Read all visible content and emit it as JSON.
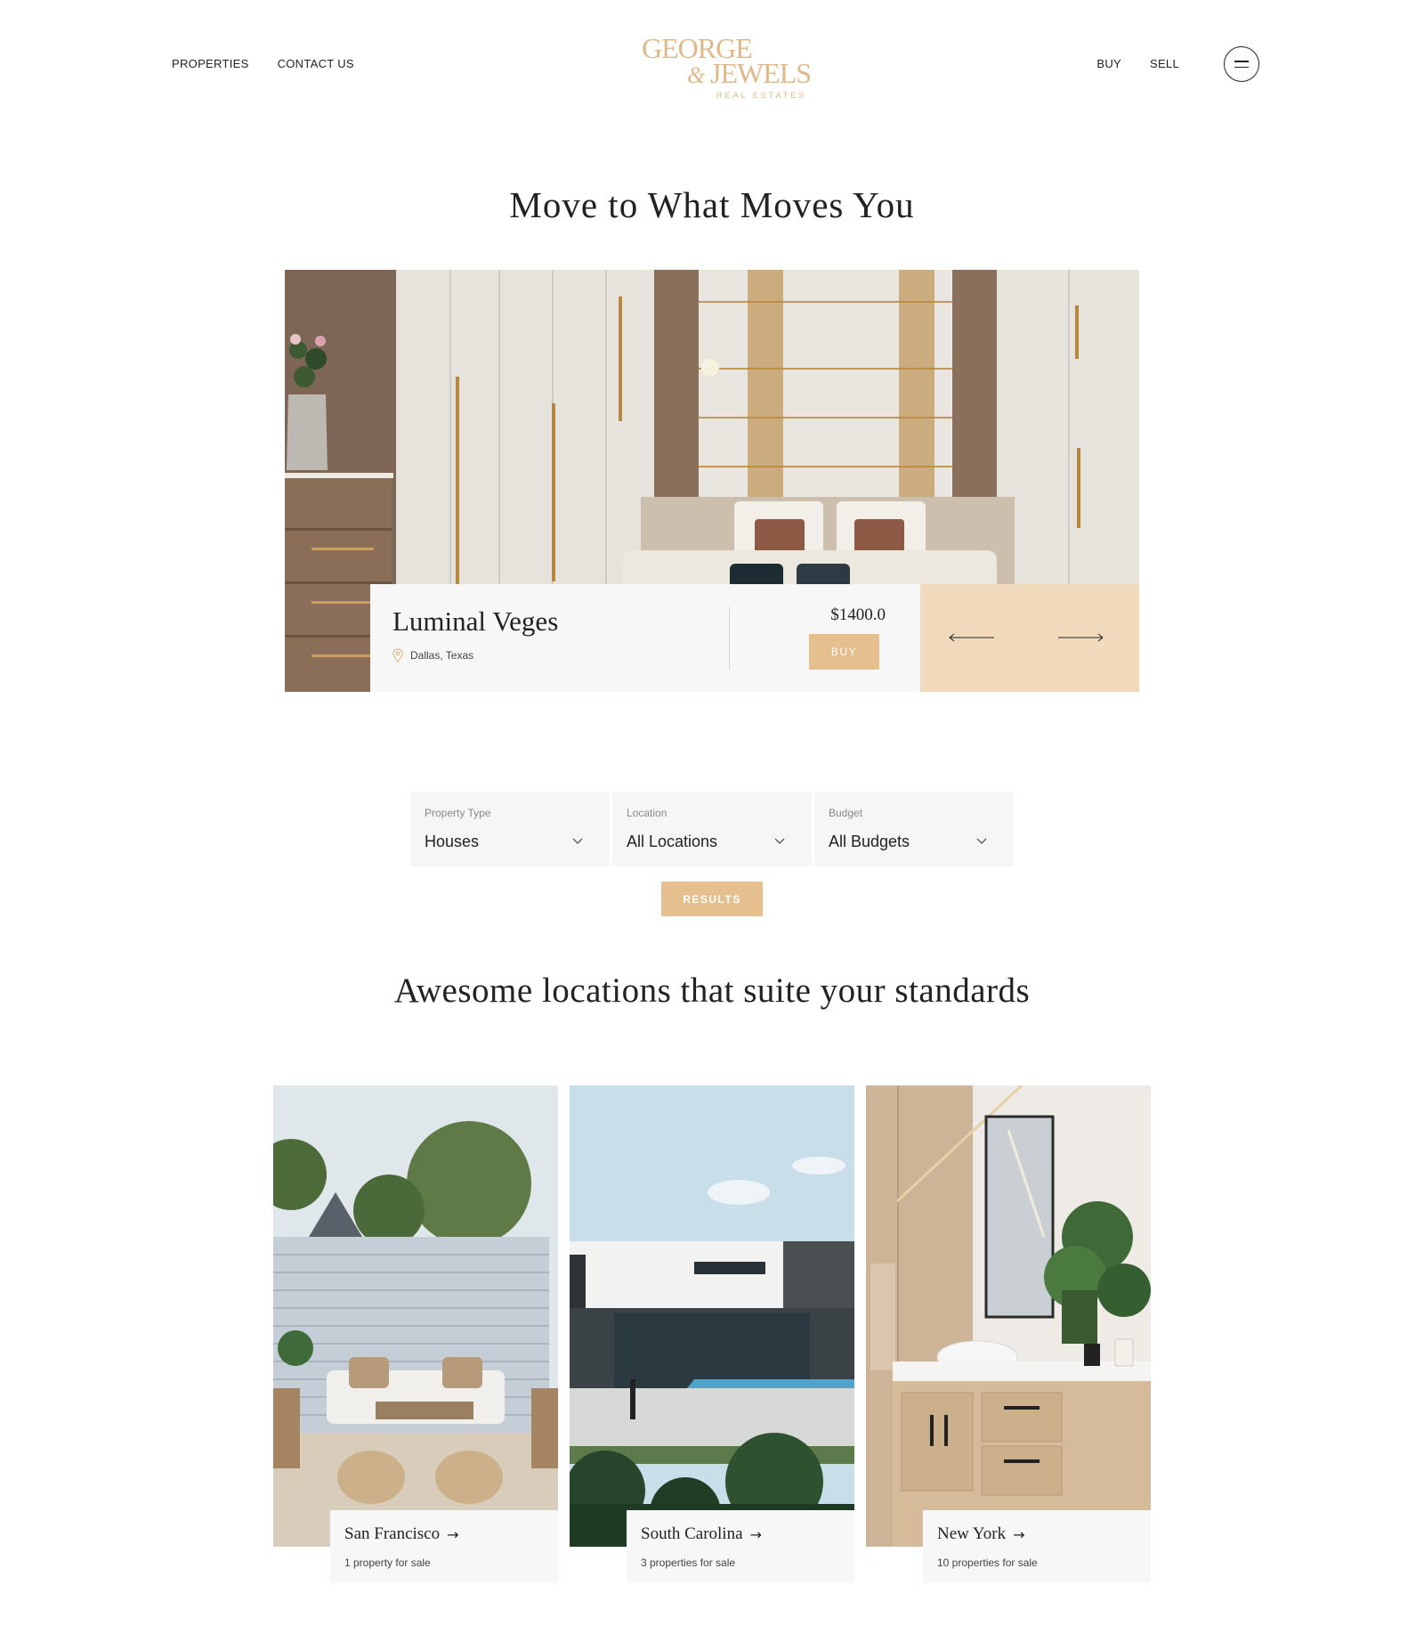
{
  "header": {
    "nav_left": [
      "PROPERTIES",
      "CONTACT US"
    ],
    "nav_right": [
      "BUY",
      "SELL"
    ],
    "logo": {
      "line1": "GEORGE",
      "amp": "&",
      "line2": "JEWELS",
      "sub": "REAL ESTATES"
    },
    "menu_icon": "hamburger-circle-icon"
  },
  "hero": {
    "title": "Move to What Moves You",
    "property_name": "Luminal Veges",
    "location": "Dallas, Texas",
    "price": "$1400.0",
    "buy_label": "BUY",
    "prev_icon": "arrow-left-icon",
    "next_icon": "arrow-right-icon"
  },
  "filter": {
    "fields": [
      {
        "label": "Property Type",
        "value": "Houses"
      },
      {
        "label": "Location",
        "value": "All Locations"
      },
      {
        "label": "Budget",
        "value": "All Budgets"
      }
    ],
    "results_label": "RESULTS"
  },
  "locations": {
    "title": "Awesome locations that suite your standards",
    "items": [
      {
        "name": "San Francisco",
        "arrow": "→",
        "count": "1 property for sale"
      },
      {
        "name": "South Carolina",
        "arrow": "→",
        "count": "3 properties for sale"
      },
      {
        "name": "New York",
        "arrow": "→",
        "count": "10 properties for sale"
      }
    ]
  },
  "colors": {
    "accent": "#e5bf8d",
    "accent_light": "#f1dabb",
    "logo": "#e0b98a",
    "text": "#222222",
    "panel": "#f7f7f7"
  }
}
